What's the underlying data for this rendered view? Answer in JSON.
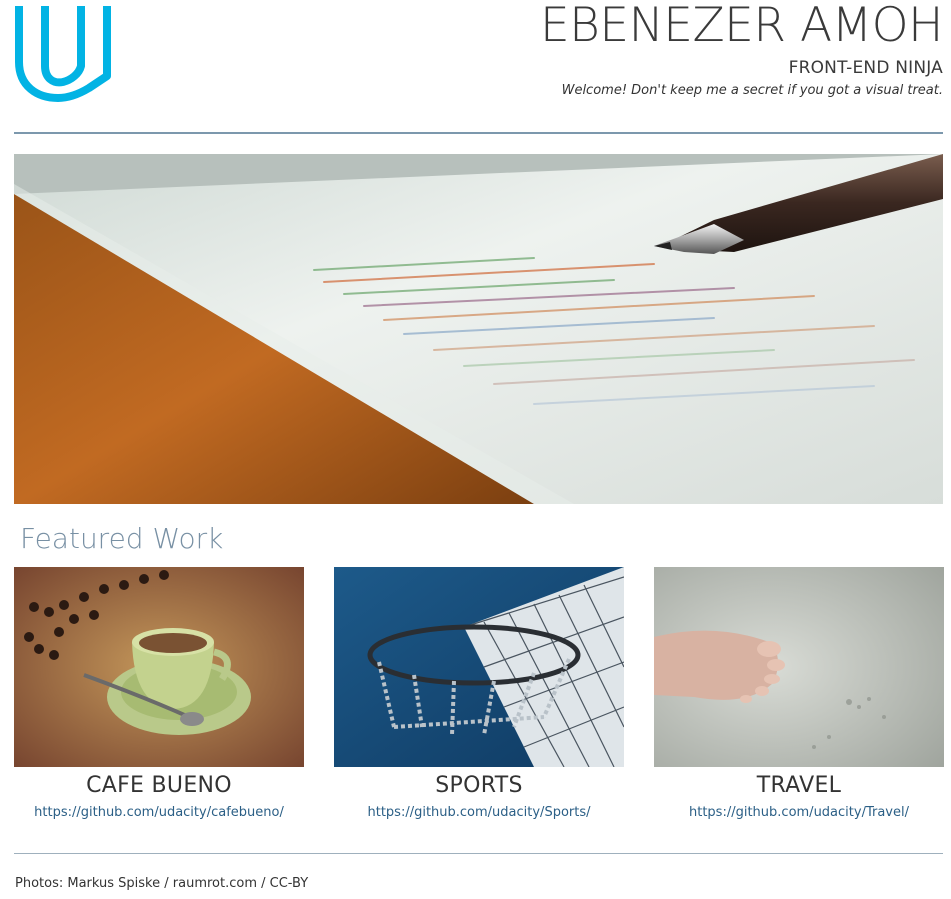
{
  "header": {
    "name": "EBENEZER AMOH",
    "role": "FRONT-END NINJA",
    "tagline": "Welcome! Don't keep me a secret if you got a visual treat."
  },
  "logo": {
    "icon": "udacity-logo-icon",
    "color": "#02b3e4"
  },
  "featured": {
    "heading": "Featured Work",
    "projects": [
      {
        "title": "CAFE BUENO",
        "link": "https://github.com/udacity/cafebueno/"
      },
      {
        "title": "SPORTS",
        "link": "https://github.com/udacity/Sports/"
      },
      {
        "title": "TRAVEL",
        "link": "https://github.com/udacity/Travel/"
      }
    ]
  },
  "footer": {
    "credits": "Photos: Markus Spiske / raumrot.com / CC-BY"
  },
  "colors": {
    "accent": "#7c98ad",
    "heading": "#7890a4",
    "link": "#2b5f86"
  }
}
